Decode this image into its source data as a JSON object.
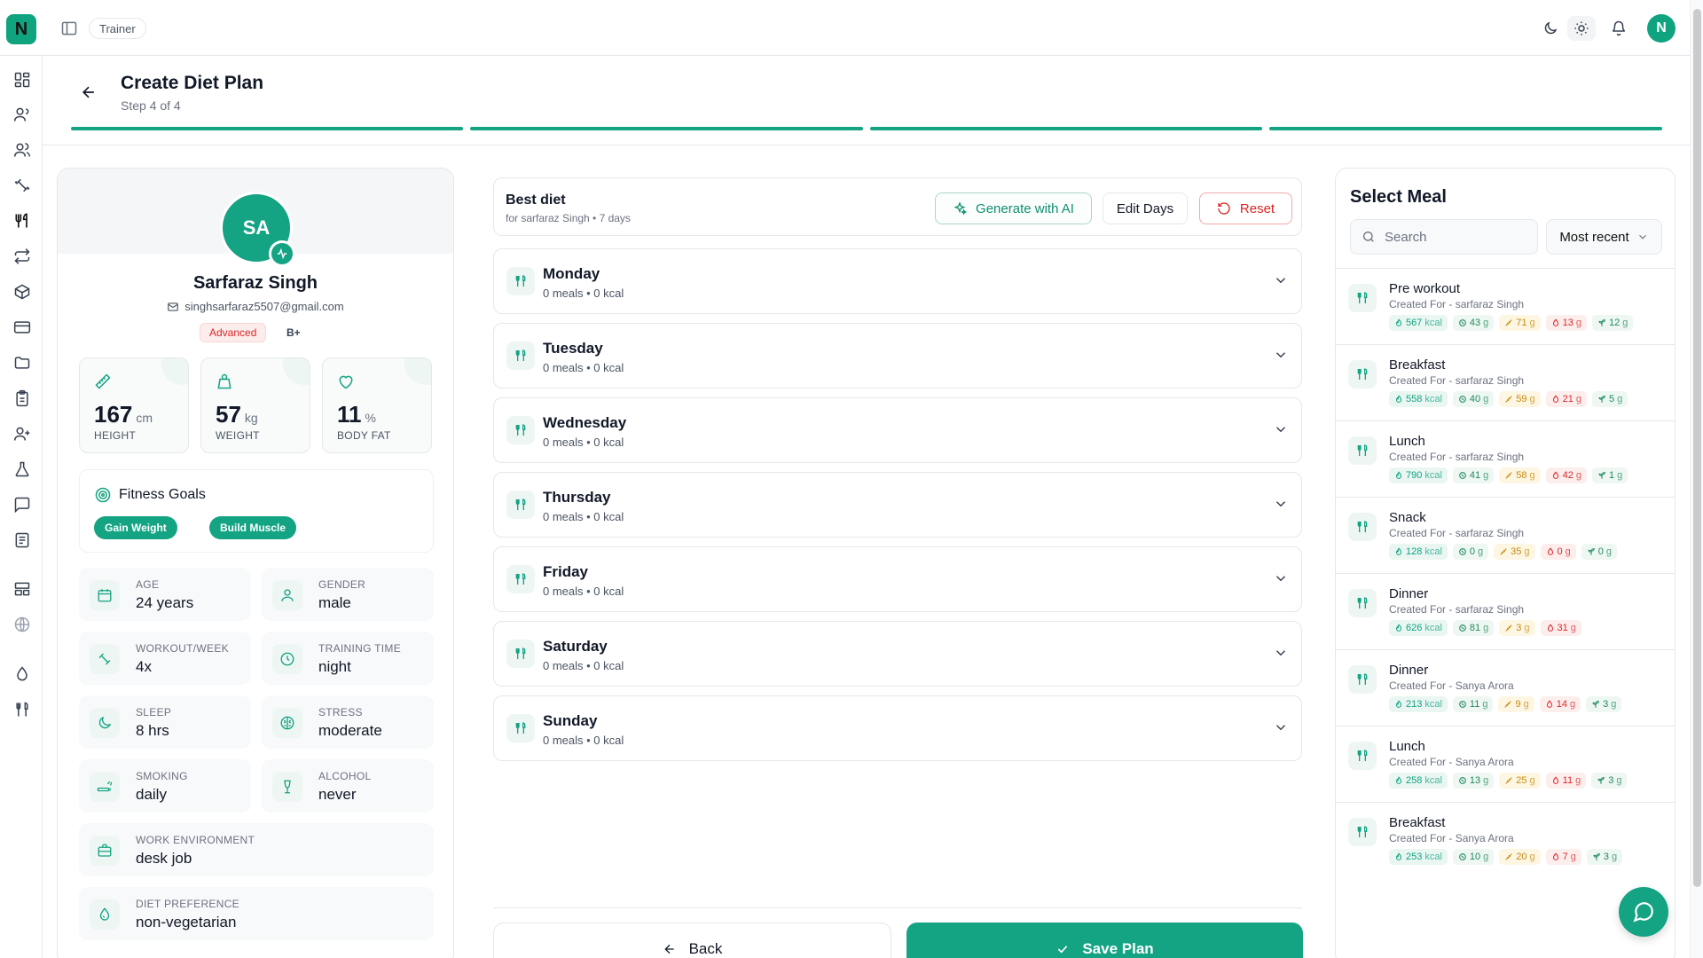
{
  "topbar": {
    "logo_letter": "N",
    "breadcrumb": "Trainer",
    "user_initial": "N"
  },
  "icons": {
    "rail": [
      "dashboard-icon",
      "users-icon",
      "clients-icon",
      "workout-icon",
      "diet-icon",
      "sync-icon",
      "package-icon",
      "billing-icon",
      "folder-icon",
      "clipboard-icon",
      "add-user-icon",
      "lab-icon",
      "chat-icon",
      "reports-icon",
      "layout-icon",
      "globe-icon",
      "water-drop-icon",
      "meal-tools-icon"
    ]
  },
  "header": {
    "title": "Create Diet Plan",
    "step": "Step 4 of 4",
    "steps_total": 4,
    "steps_completed": 4
  },
  "profile": {
    "initials": "SA",
    "name": "Sarfaraz Singh",
    "email": "singhsarfaraz5507@gmail.com",
    "level": "Advanced",
    "blood_group": "B+",
    "stats": [
      {
        "value": "167",
        "unit": "cm",
        "label": "HEIGHT",
        "icon": "ruler-icon"
      },
      {
        "value": "57",
        "unit": "kg",
        "label": "WEIGHT",
        "icon": "weight-icon"
      },
      {
        "value": "11",
        "unit": "%",
        "label": "BODY FAT",
        "icon": "heart-icon"
      }
    ],
    "goals_title": "Fitness Goals",
    "goals": [
      "Gain Weight",
      "Build Muscle"
    ],
    "info": [
      {
        "label": "AGE",
        "value": "24 years",
        "icon": "calendar-icon"
      },
      {
        "label": "GENDER",
        "value": "male",
        "icon": "person-icon"
      },
      {
        "label": "WORKOUT/WEEK",
        "value": "4x",
        "icon": "dumbbell-icon"
      },
      {
        "label": "TRAINING TIME",
        "value": "night",
        "icon": "clock-icon"
      },
      {
        "label": "SLEEP",
        "value": "8 hrs",
        "icon": "moon-icon"
      },
      {
        "label": "STRESS",
        "value": "moderate",
        "icon": "brain-icon"
      },
      {
        "label": "SMOKING",
        "value": "daily",
        "icon": "smoking-icon"
      },
      {
        "label": "ALCOHOL",
        "value": "never",
        "icon": "wine-icon"
      },
      {
        "label": "WORK ENVIRONMENT",
        "value": "desk job",
        "icon": "briefcase-icon"
      },
      {
        "label": "DIET PREFERENCE",
        "value": "non-vegetarian",
        "icon": "leaf-drop-icon"
      }
    ]
  },
  "plan": {
    "name": "Best diet",
    "subtitle": "for sarfaraz Singh • 7 days",
    "generate_label": "Generate with AI",
    "edit_label": "Edit Days",
    "reset_label": "Reset",
    "days": [
      {
        "name": "Monday",
        "summary": "0 meals • 0 kcal"
      },
      {
        "name": "Tuesday",
        "summary": "0 meals • 0 kcal"
      },
      {
        "name": "Wednesday",
        "summary": "0 meals • 0 kcal"
      },
      {
        "name": "Thursday",
        "summary": "0 meals • 0 kcal"
      },
      {
        "name": "Friday",
        "summary": "0 meals • 0 kcal"
      },
      {
        "name": "Saturday",
        "summary": "0 meals • 0 kcal"
      },
      {
        "name": "Sunday",
        "summary": "0 meals • 0 kcal"
      }
    ],
    "back_label": "Back",
    "save_label": "Save Plan"
  },
  "meals": {
    "title": "Select Meal",
    "search_placeholder": "Search",
    "sort_label": "Most recent",
    "items": [
      {
        "name": "Pre workout",
        "by": "Created For - sarfaraz Singh",
        "kcal": "567",
        "protein": "43",
        "carbs": "71",
        "fat": "13",
        "fiber": "12"
      },
      {
        "name": "Breakfast",
        "by": "Created For - sarfaraz Singh",
        "kcal": "558",
        "protein": "40",
        "carbs": "59",
        "fat": "21",
        "fiber": "5"
      },
      {
        "name": "Lunch",
        "by": "Created For - sarfaraz Singh",
        "kcal": "790",
        "protein": "41",
        "carbs": "58",
        "fat": "42",
        "fiber": "1"
      },
      {
        "name": "Snack",
        "by": "Created For - sarfaraz Singh",
        "kcal": "128",
        "protein": "0",
        "carbs": "35",
        "fat": "0",
        "fiber": "0"
      },
      {
        "name": "Dinner",
        "by": "Created For - sarfaraz Singh",
        "kcal": "626",
        "protein": "81",
        "carbs": "3",
        "fat": "31",
        "fiber": null
      },
      {
        "name": "Dinner",
        "by": "Created For - Sanya Arora",
        "kcal": "213",
        "protein": "11",
        "carbs": "9",
        "fat": "14",
        "fiber": "3"
      },
      {
        "name": "Lunch",
        "by": "Created For - Sanya Arora",
        "kcal": "258",
        "protein": "13",
        "carbs": "25",
        "fat": "11",
        "fiber": "3"
      },
      {
        "name": "Breakfast",
        "by": "Created For - Sanya Arora",
        "kcal": "253",
        "protein": "10",
        "carbs": "20",
        "fat": "7",
        "fiber": "3"
      }
    ],
    "units": {
      "kcal": "kcal",
      "g": "g"
    }
  },
  "colors": {
    "accent": "#14a383",
    "danger": "#dc2626",
    "carb": "#c68a10"
  }
}
